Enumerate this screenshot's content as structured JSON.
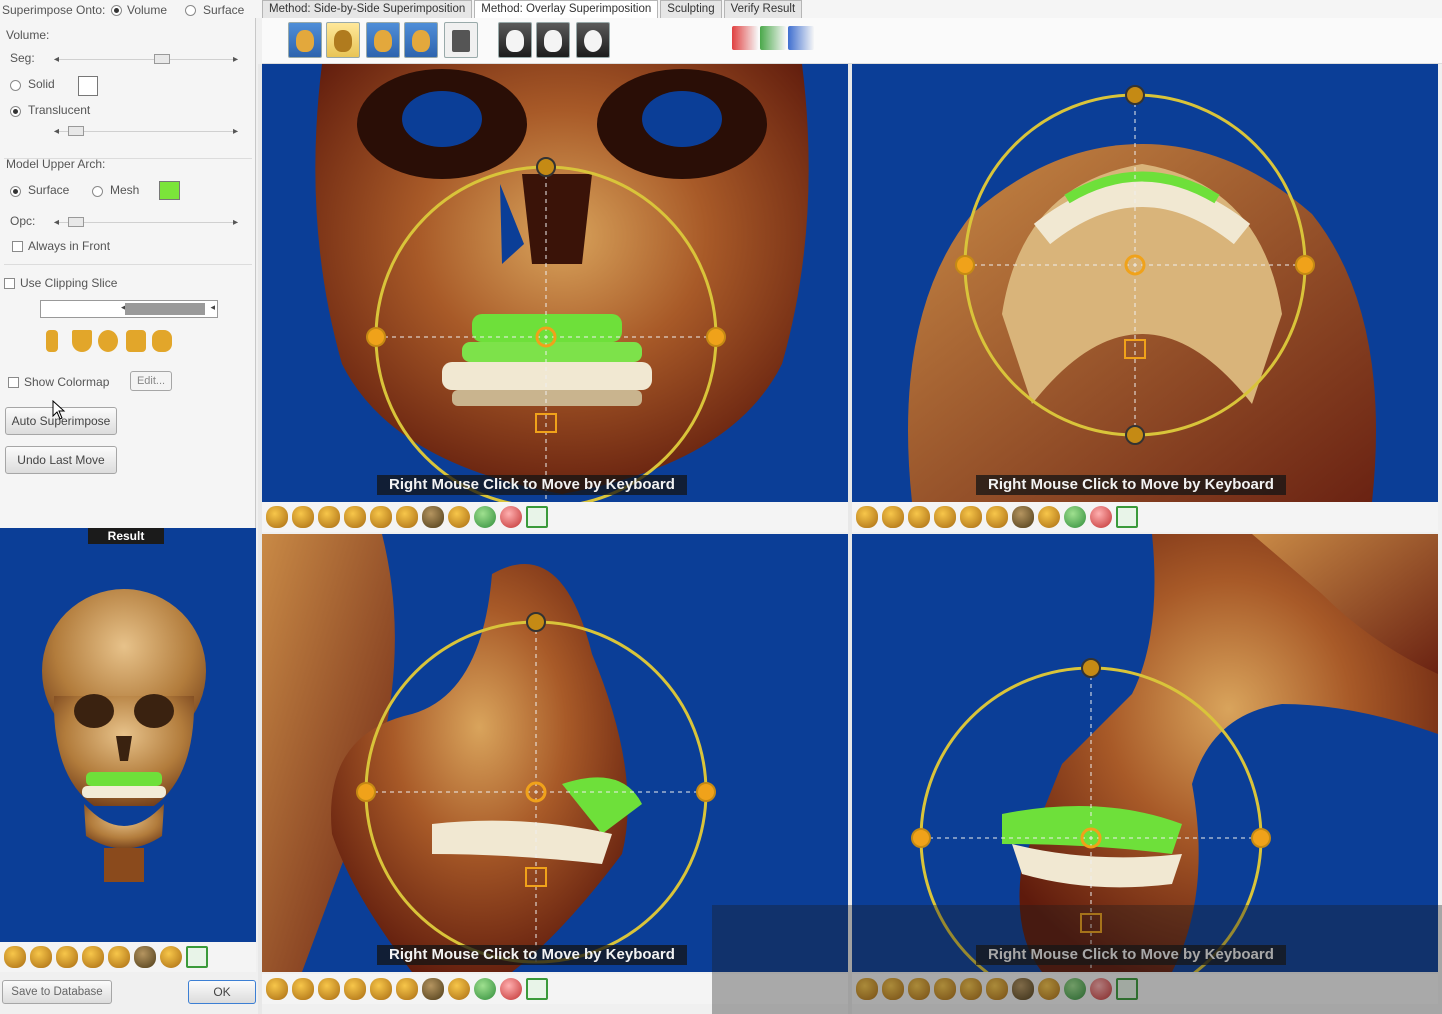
{
  "top": {
    "superimpose_label": "Superimpose Onto:",
    "opt_volume": "Volume",
    "opt_surface": "Surface"
  },
  "tabs": [
    {
      "label": "Method: Side-by-Side Superimposition",
      "active": false
    },
    {
      "label": "Method: Overlay Superimposition",
      "active": true
    },
    {
      "label": "Sculpting",
      "active": false
    },
    {
      "label": "Verify Result",
      "active": false
    }
  ],
  "left": {
    "volume_label": "Volume:",
    "seg_label": "Seg:",
    "solid_label": "Solid",
    "translucent_label": "Translucent",
    "model_label": "Model Upper Arch:",
    "surface_label": "Surface",
    "mesh_label": "Mesh",
    "opc_label": "Opc:",
    "always_front_label": "Always in Front",
    "clipping_label": "Use Clipping Slice",
    "colormap_label": "Show Colormap",
    "edit_label": "Edit...",
    "auto_label": "Auto Superimpose",
    "undo_label": "Undo Last Move",
    "model_color": "#7be53a"
  },
  "result": {
    "title": "Result"
  },
  "footer": {
    "save_label": "Save to Database",
    "ok_label": "OK"
  },
  "viewports": {
    "caption": "Right Mouse Click to Move by Keyboard"
  },
  "colors": {
    "viewport_bg": "#0b3e97",
    "ring": "#d9c43a",
    "handle": "#f0a21a",
    "teeth_model": "#6ee03a"
  }
}
